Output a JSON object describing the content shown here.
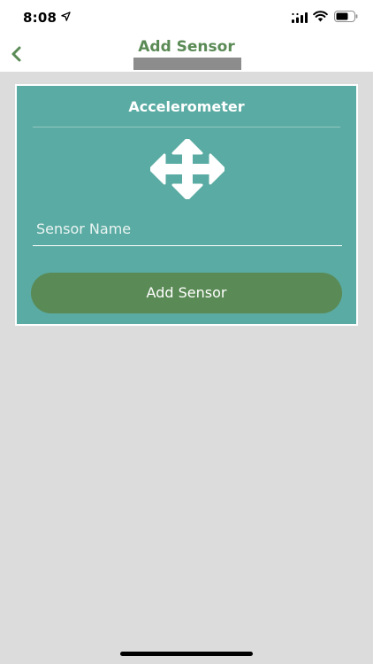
{
  "status_bar": {
    "time": "8:08",
    "icons": [
      "location-arrow-icon",
      "cellular-signal-icon",
      "wifi-icon",
      "battery-icon"
    ]
  },
  "nav": {
    "title": "Add Sensor",
    "back_icon": "chevron-left-icon"
  },
  "card": {
    "title": "Accelerometer",
    "icon": "move-arrows-icon",
    "input": {
      "placeholder": "Sensor Name",
      "value": ""
    },
    "button_label": "Add Sensor"
  },
  "colors": {
    "accent_green": "#5a8a55",
    "card_teal": "#5aaba3",
    "background": "#dcdcdc"
  }
}
